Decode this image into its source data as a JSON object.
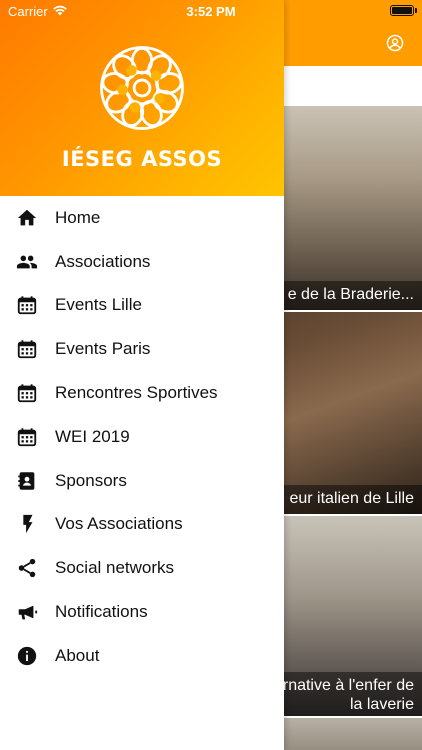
{
  "status_bar": {
    "carrier": "Carrier",
    "time": "3:52 PM"
  },
  "drawer": {
    "brand": "IÉSEG ASSOS",
    "menu": [
      {
        "label": "Home",
        "icon": "home-icon"
      },
      {
        "label": "Associations",
        "icon": "people-icon"
      },
      {
        "label": "Events Lille",
        "icon": "calendar-icon"
      },
      {
        "label": "Events Paris",
        "icon": "calendar-icon"
      },
      {
        "label": "Rencontres Sportives",
        "icon": "calendar-icon"
      },
      {
        "label": "WEI 2019",
        "icon": "calendar-icon"
      },
      {
        "label": "Sponsors",
        "icon": "contacts-icon"
      },
      {
        "label": "Vos Associations",
        "icon": "flash-icon"
      },
      {
        "label": "Social networks",
        "icon": "share-icon"
      },
      {
        "label": "Notifications",
        "icon": "megaphone-icon"
      },
      {
        "label": "About",
        "icon": "info-icon"
      }
    ]
  },
  "feed": {
    "cards": [
      {
        "caption": "e de la Braderie..."
      },
      {
        "caption": "eur italien de Lille"
      },
      {
        "caption_line1": "rnative à l'enfer de",
        "caption_line2": "la laverie"
      }
    ]
  },
  "colors": {
    "header_orange": "#ff9d00",
    "gradient_start": "#ff7a00",
    "gradient_end": "#ffc400"
  }
}
